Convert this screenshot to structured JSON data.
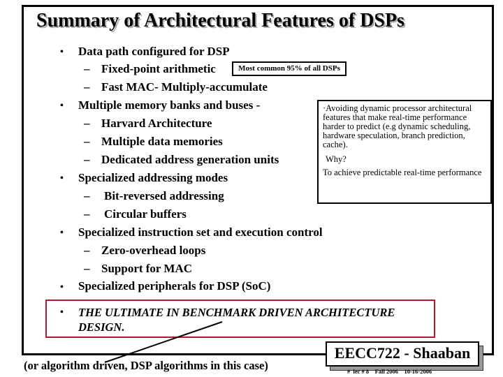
{
  "slide": {
    "title": "Summary of Architectural Features of DSPs",
    "bullet_glyph": "•",
    "dash_glyph": "–",
    "items": [
      {
        "text": "Data path configured for DSP",
        "subitems": [
          "Fixed-point arithmetic",
          "Fast MAC- Multiply-accumulate"
        ]
      },
      {
        "text": "Multiple memory banks and buses -",
        "subitems": [
          "Harvard Architecture",
          "Multiple data memories",
          "Dedicated address generation units"
        ]
      },
      {
        "text": "Specialized addressing modes",
        "subitems": [
          " Bit-reversed addressing",
          " Circular buffers"
        ]
      },
      {
        "text": "Specialized instruction set and execution control",
        "subitems": [
          "Zero-overhead loops",
          "Support for MAC"
        ]
      },
      {
        "text": "Specialized peripherals for DSP (SoC)",
        "subitems": []
      }
    ],
    "fixed_point_note": "Most common 95% of all DSPs",
    "side_note": {
      "paragraph": "·Avoiding  dynamic processor architectural features that make real-time performance harder to predict (e.g dynamic scheduling, hardware speculation,  branch prediction, cache).",
      "question": "Why?",
      "answer": "To achieve predictable real-time performance"
    },
    "highlight": {
      "text": "THE ULTIMATE IN BENCHMARK DRIVEN ARCHITECTURE DESIGN.",
      "border_color": "#b01a30"
    },
    "caption": "(or algorithm driven, DSP algorithms in this case)",
    "footer": {
      "course": "EECC722 - Shaaban",
      "meta": "#  lec # 8    Fall 2006    10-16-2006"
    }
  }
}
